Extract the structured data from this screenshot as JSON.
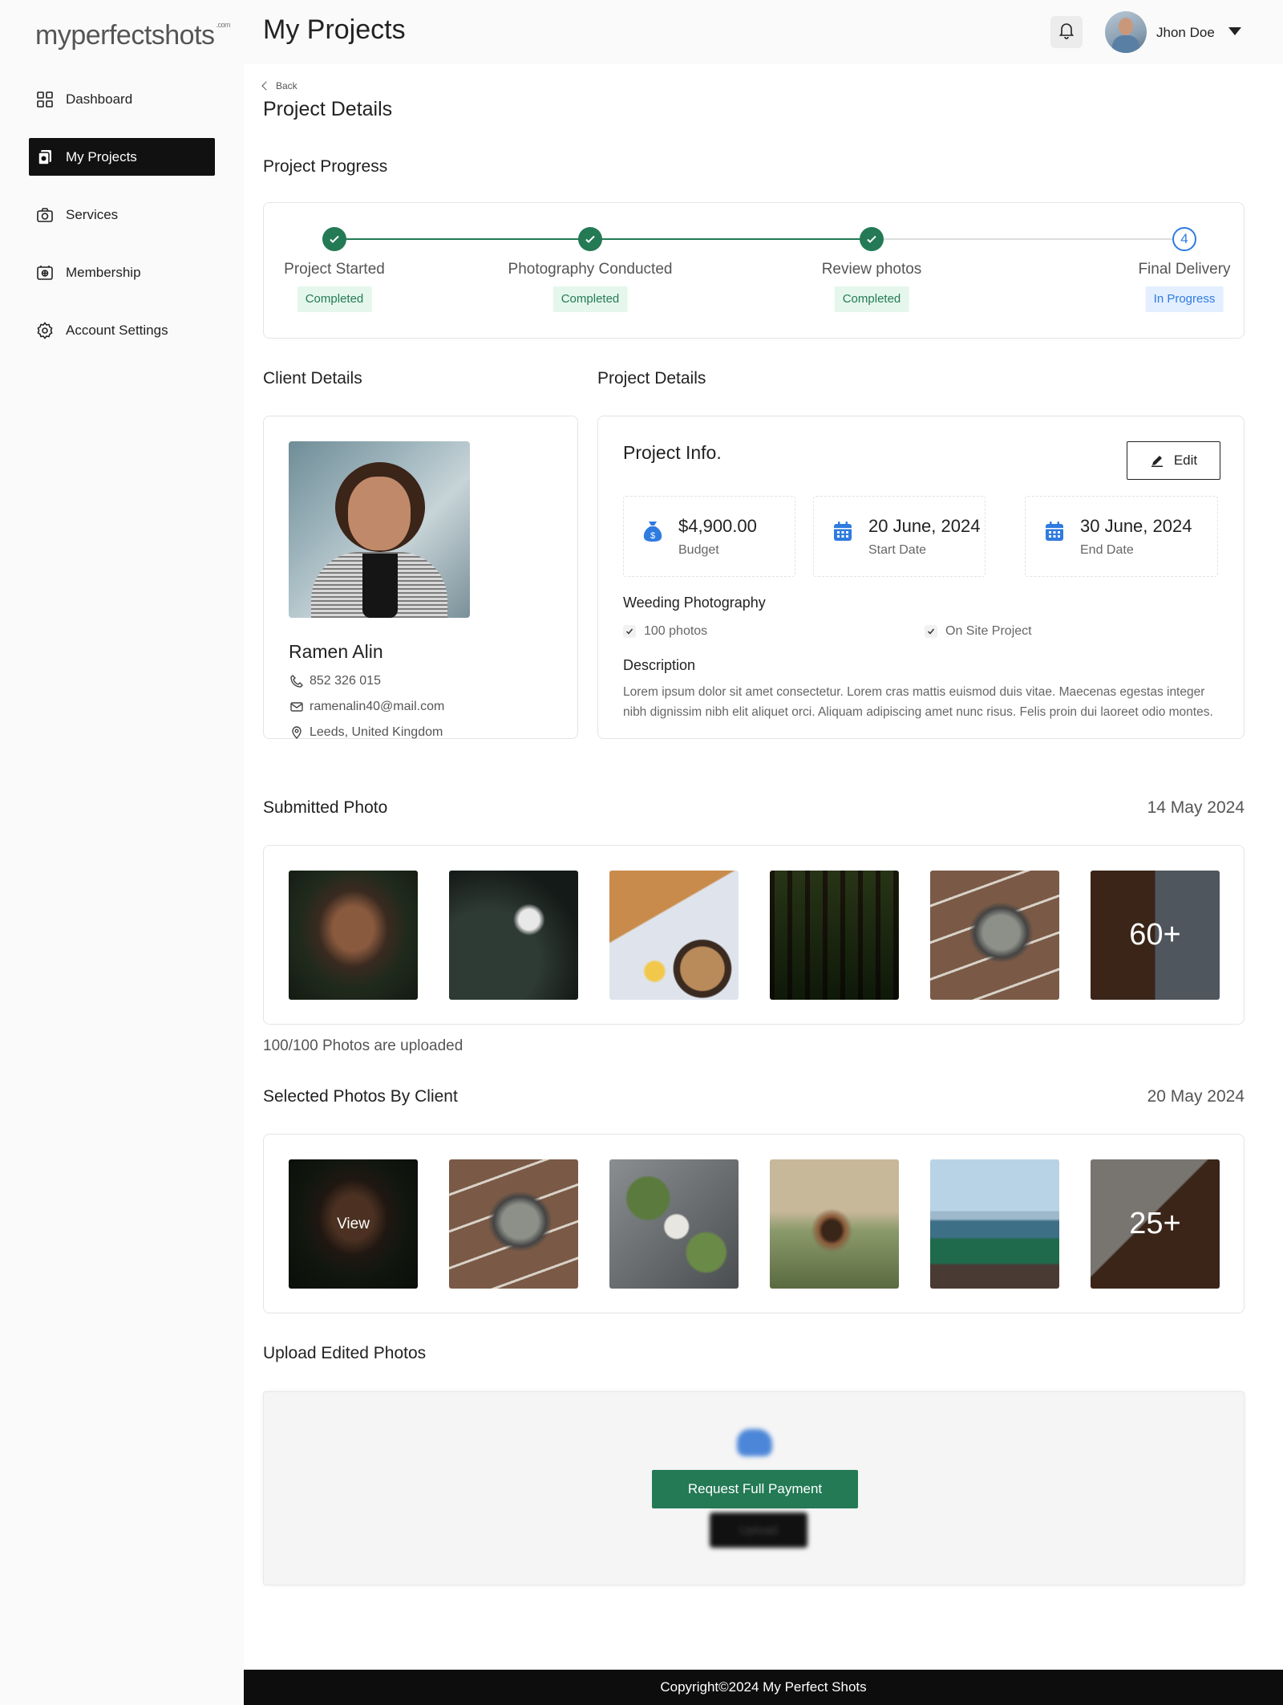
{
  "brand": {
    "logo_text": "myperfectshots",
    "logo_suffix": ".com"
  },
  "sidebar": {
    "items": [
      {
        "label": "Dashboard",
        "icon": "grid-icon",
        "active": false
      },
      {
        "label": "My Projects",
        "icon": "projects-icon",
        "active": true
      },
      {
        "label": "Services",
        "icon": "camera-icon",
        "active": false
      },
      {
        "label": "Membership",
        "icon": "membership-icon",
        "active": false
      },
      {
        "label": "Account Settings",
        "icon": "gear-icon",
        "active": false
      }
    ]
  },
  "header": {
    "title": "My Projects",
    "user_name": "Jhon Doe",
    "notification_icon": "bell-icon"
  },
  "page": {
    "back_label": "Back",
    "title": "Project Details"
  },
  "progress": {
    "title": "Project Progress",
    "steps": [
      {
        "name": "Project Started",
        "status": "Completed",
        "marker": ""
      },
      {
        "name": "Photography Conducted",
        "status": "Completed",
        "marker": ""
      },
      {
        "name": "Review photos",
        "status": "Completed",
        "marker": ""
      },
      {
        "name": "Final Delivery",
        "status": "In Progress",
        "marker": "4"
      }
    ]
  },
  "client": {
    "section_title": "Client Details",
    "name": "Ramen Alin",
    "phone": "852 326 015",
    "email": "ramenalin40@mail.com",
    "location": "Leeds, United Kingdom"
  },
  "project": {
    "section_title": "Project Details",
    "info_title": "Project Info.",
    "edit_label": "Edit",
    "budget_value": "$4,900.00",
    "budget_label": "Budget",
    "start_value": "20 June, 2024",
    "start_label": "Start Date",
    "end_value": "30 June, 2024",
    "end_label": "End Date",
    "package": "Weeding Photography",
    "features": [
      "100 photos",
      "On Site Project"
    ],
    "description_title": "Description",
    "description": "Lorem ipsum dolor sit amet consectetur. Lorem cras mattis euismod duis vitae. Maecenas egestas integer nibh dignissim nibh elit aliquet orci. Aliquam adipiscing amet nunc risus. Felis proin dui laoreet odio montes."
  },
  "submitted": {
    "title": "Submitted Photo",
    "date": "14 May 2024",
    "more_label": "60+",
    "uploaded_text": "100/100 Photos are uploaded"
  },
  "selected": {
    "title": "Selected Photos By Client",
    "date": "20 May 2024",
    "view_label": "View",
    "more_label": "25+"
  },
  "upload": {
    "title": "Upload Edited Photos",
    "request_label": "Request Full Payment",
    "upload_label": "Upload"
  },
  "footer": {
    "copyright": "Copyright©2024 My Perfect Shots"
  },
  "colors": {
    "accent_green": "#237a55",
    "accent_blue": "#2f7be0",
    "dark": "#111111"
  }
}
